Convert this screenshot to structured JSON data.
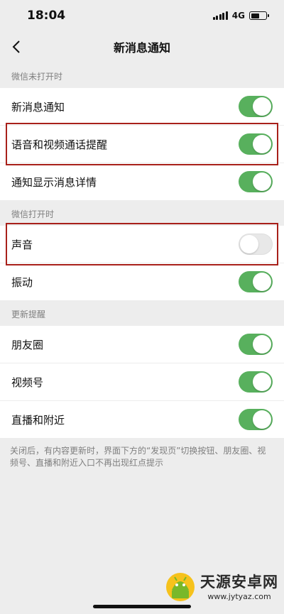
{
  "status": {
    "time": "18:04",
    "network": "4G",
    "battery_level": 0.55
  },
  "nav": {
    "title": "新消息通知"
  },
  "sections": [
    {
      "label": "微信未打开时",
      "items": [
        {
          "label": "新消息通知",
          "on": true
        },
        {
          "label": "语音和视频通话提醒",
          "on": true,
          "highlighted": true
        },
        {
          "label": "通知显示消息详情",
          "on": true
        }
      ]
    },
    {
      "label": "微信打开时",
      "items": [
        {
          "label": "声音",
          "on": false,
          "highlighted": true
        },
        {
          "label": "振动",
          "on": true
        }
      ]
    },
    {
      "label": "更新提醒",
      "items": [
        {
          "label": "朋友圈",
          "on": true
        },
        {
          "label": "视频号",
          "on": true
        },
        {
          "label": "直播和附近",
          "on": true
        }
      ]
    }
  ],
  "footnote": "关闭后，有内容更新时，界面下方的“发现页”切换按钮、朋友圈、视频号、直播和附近入口不再出现红点提示",
  "watermark": {
    "name": "天源安卓网",
    "url": "www.jytyaz.com"
  },
  "colors": {
    "toggle_on": "#58b05d",
    "highlight": "#a8201a",
    "background": "#ededed"
  }
}
